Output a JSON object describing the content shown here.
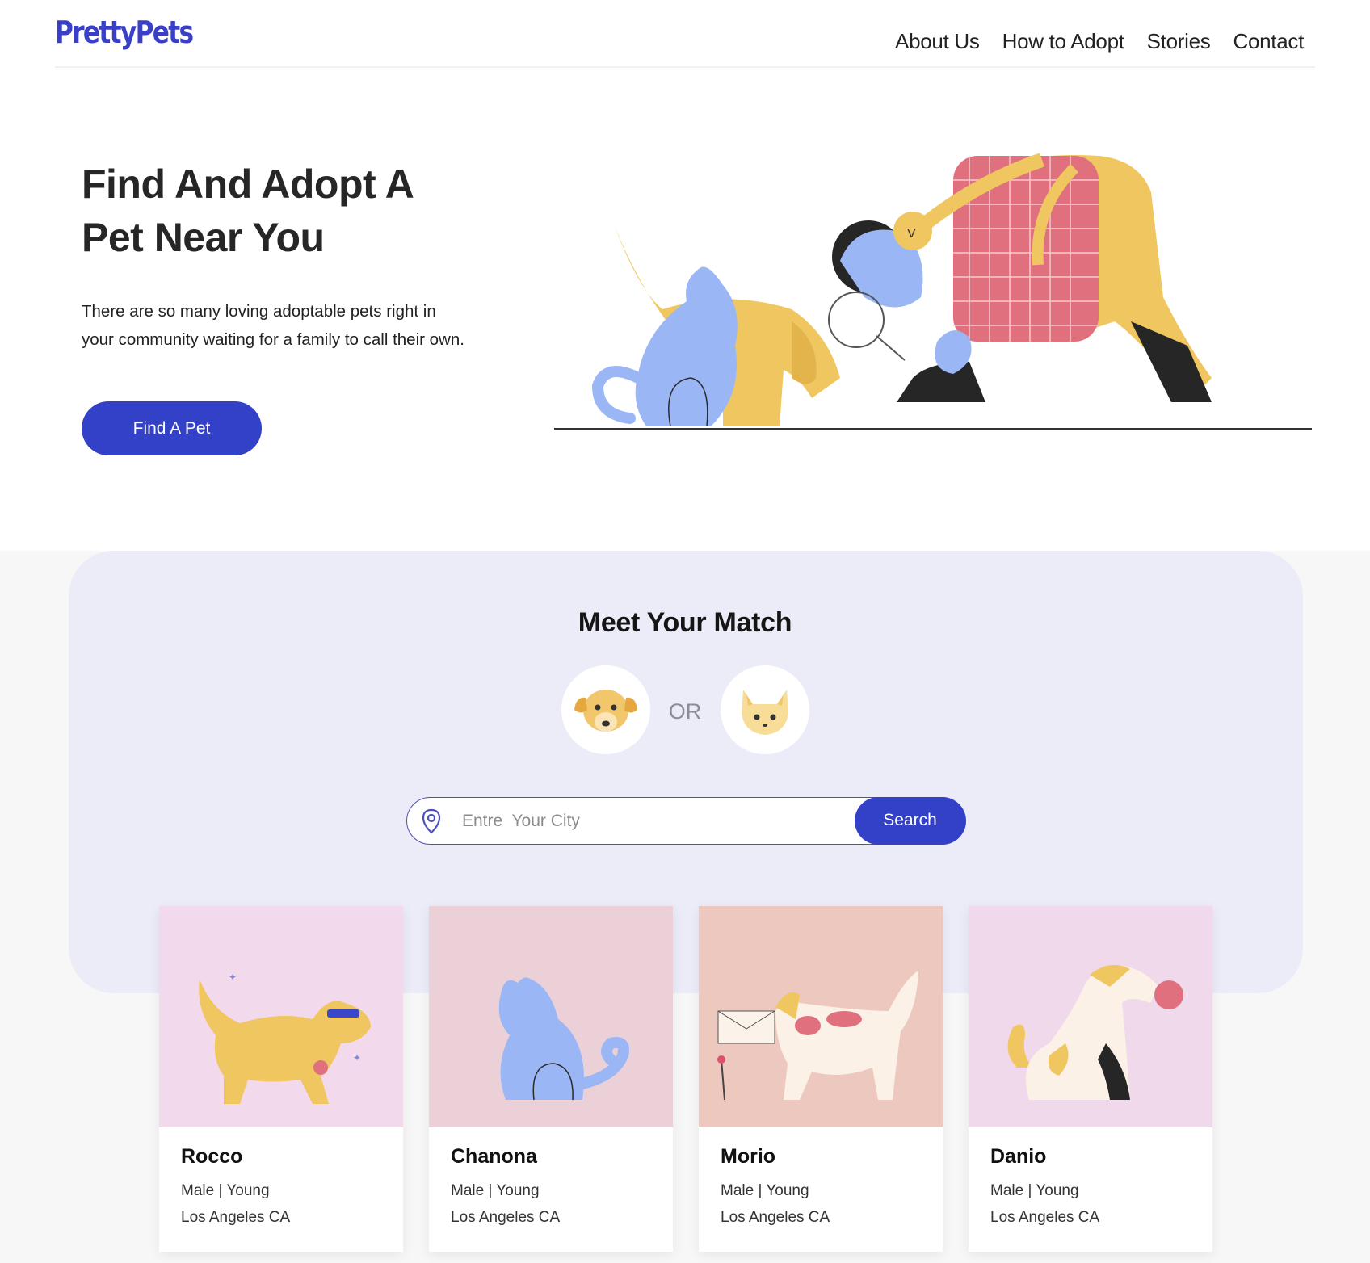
{
  "brand": {
    "logo_text": "PrettyPets",
    "accent": "#3340c8"
  },
  "nav": {
    "items": [
      "About Us",
      "How to Adopt",
      "Stories",
      "Contact"
    ]
  },
  "hero": {
    "title_line1": "Find And Adopt A",
    "title_line2": "Pet Near You",
    "description": "There are so many loving adoptable pets right in your community waiting for a family to call their own.",
    "cta_label": "Find A Pet"
  },
  "match": {
    "title": "Meet Your Match",
    "or_label": "OR",
    "dog_icon": "dog-face-icon",
    "cat_icon": "cat-face-icon"
  },
  "search": {
    "placeholder": "Entre  Your City",
    "value": "",
    "button_label": "Search",
    "icon": "location-pin-icon"
  },
  "pets": [
    {
      "name": "Rocco",
      "meta": "Male | Young",
      "location": "Los Angeles CA",
      "bg": "#f2d9ec"
    },
    {
      "name": "Chanona",
      "meta": "Male | Young",
      "location": "Los Angeles CA",
      "bg": "#ecd0d8"
    },
    {
      "name": "Morio",
      "meta": "Male | Young",
      "location": "Los Angeles CA",
      "bg": "#edc8bf"
    },
    {
      "name": "Danio",
      "meta": "Male | Young",
      "location": "Los Angeles CA",
      "bg": "#f1d9ec"
    }
  ]
}
